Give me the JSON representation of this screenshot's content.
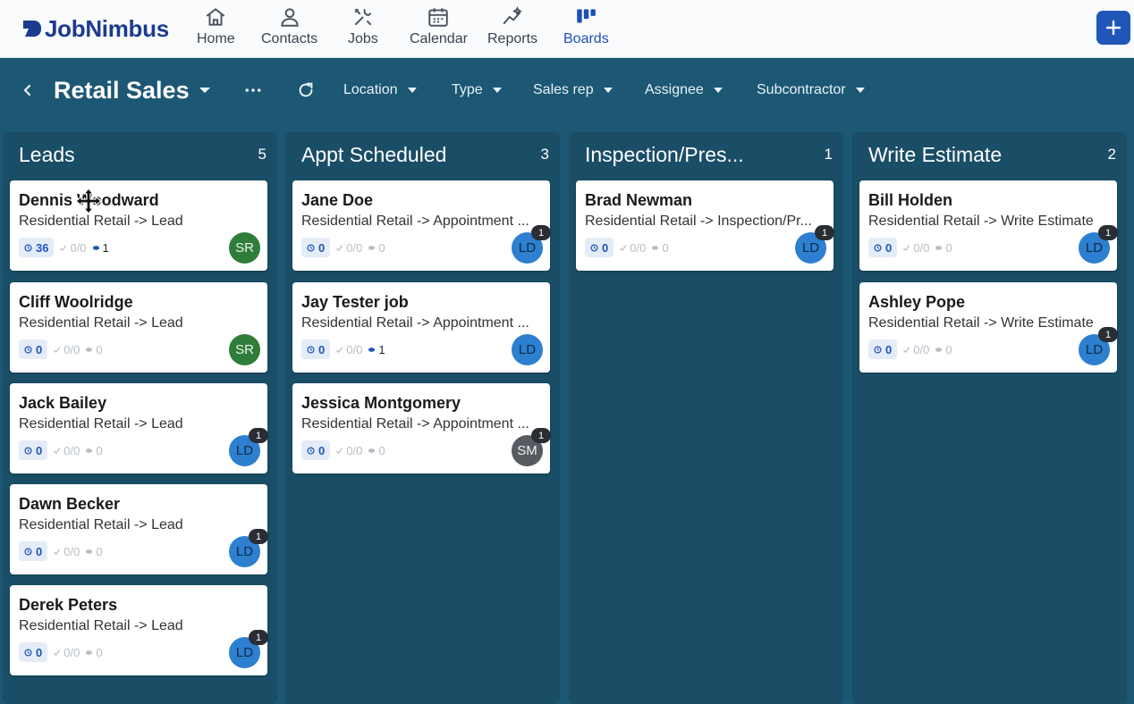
{
  "brand": {
    "name": "JobNimbus"
  },
  "nav": {
    "items": [
      {
        "label": "Home",
        "icon": "home-icon",
        "active": false
      },
      {
        "label": "Contacts",
        "icon": "person-icon",
        "active": false
      },
      {
        "label": "Jobs",
        "icon": "tools-icon",
        "active": false
      },
      {
        "label": "Calendar",
        "icon": "calendar-icon",
        "active": false
      },
      {
        "label": "Reports",
        "icon": "sparkle-chart-icon",
        "active": false
      },
      {
        "label": "Boards",
        "icon": "boards-icon",
        "active": true
      }
    ],
    "add_icon": "plus-icon"
  },
  "toolbar": {
    "title": "Retail Sales",
    "filters": [
      "Location",
      "Type",
      "Sales rep",
      "Assignee",
      "Subcontractor"
    ]
  },
  "colors": {
    "brand": "#1b3b8f",
    "accent": "#1f56b8",
    "board_bg": "#1c5774",
    "column_bg": "#1a4d66",
    "avatar_sr": "#2f7d3a",
    "avatar_ld": "#2d7fcf",
    "avatar_sm": "#555b61"
  },
  "columns": [
    {
      "title": "Leads",
      "count": "5",
      "cards": [
        {
          "name": "Dennis Woodward",
          "sub": "Residential Retail -> Lead",
          "pill": "36",
          "tasks": "0/0",
          "notes": "1",
          "notes_active": true,
          "avatar": "SR",
          "badge": ""
        },
        {
          "name": "Cliff Woolridge",
          "sub": "Residential Retail -> Lead",
          "pill": "0",
          "tasks": "0/0",
          "notes": "0",
          "notes_active": false,
          "avatar": "SR",
          "badge": ""
        },
        {
          "name": "Jack Bailey",
          "sub": "Residential Retail -> Lead",
          "pill": "0",
          "tasks": "0/0",
          "notes": "0",
          "notes_active": false,
          "avatar": "LD",
          "badge": "1"
        },
        {
          "name": "Dawn Becker",
          "sub": "Residential Retail -> Lead",
          "pill": "0",
          "tasks": "0/0",
          "notes": "0",
          "notes_active": false,
          "avatar": "LD",
          "badge": "1"
        },
        {
          "name": "Derek Peters",
          "sub": "Residential Retail -> Lead",
          "pill": "0",
          "tasks": "0/0",
          "notes": "0",
          "notes_active": false,
          "avatar": "LD",
          "badge": "1"
        }
      ]
    },
    {
      "title": "Appt Scheduled",
      "count": "3",
      "cards": [
        {
          "name": "Jane Doe",
          "sub": "Residential Retail -> Appointment ...",
          "pill": "0",
          "tasks": "0/0",
          "notes": "0",
          "notes_active": false,
          "avatar": "LD",
          "badge": "1"
        },
        {
          "name": "Jay Tester job",
          "sub": "Residential Retail -> Appointment ...",
          "pill": "0",
          "tasks": "0/0",
          "notes": "1",
          "notes_active": true,
          "avatar": "LD",
          "badge": ""
        },
        {
          "name": "Jessica Montgomery",
          "sub": "Residential Retail -> Appointment ...",
          "pill": "0",
          "tasks": "0/0",
          "notes": "0",
          "notes_active": false,
          "avatar": "SM",
          "badge": "1"
        }
      ]
    },
    {
      "title": "Inspection/Pres...",
      "count": "1",
      "cards": [
        {
          "name": "Brad Newman",
          "sub": "Residential Retail -> Inspection/Pr...",
          "pill": "0",
          "tasks": "0/0",
          "notes": "0",
          "notes_active": false,
          "avatar": "LD",
          "badge": "1"
        }
      ]
    },
    {
      "title": "Write Estimate",
      "count": "2",
      "cards": [
        {
          "name": "Bill Holden",
          "sub": "Residential Retail -> Write Estimate",
          "pill": "0",
          "tasks": "0/0",
          "notes": "0",
          "notes_active": false,
          "avatar": "LD",
          "badge": "1"
        },
        {
          "name": "Ashley Pope",
          "sub": "Residential Retail -> Write Estimate",
          "pill": "0",
          "tasks": "0/0",
          "notes": "0",
          "notes_active": false,
          "avatar": "LD",
          "badge": "1"
        }
      ]
    }
  ]
}
